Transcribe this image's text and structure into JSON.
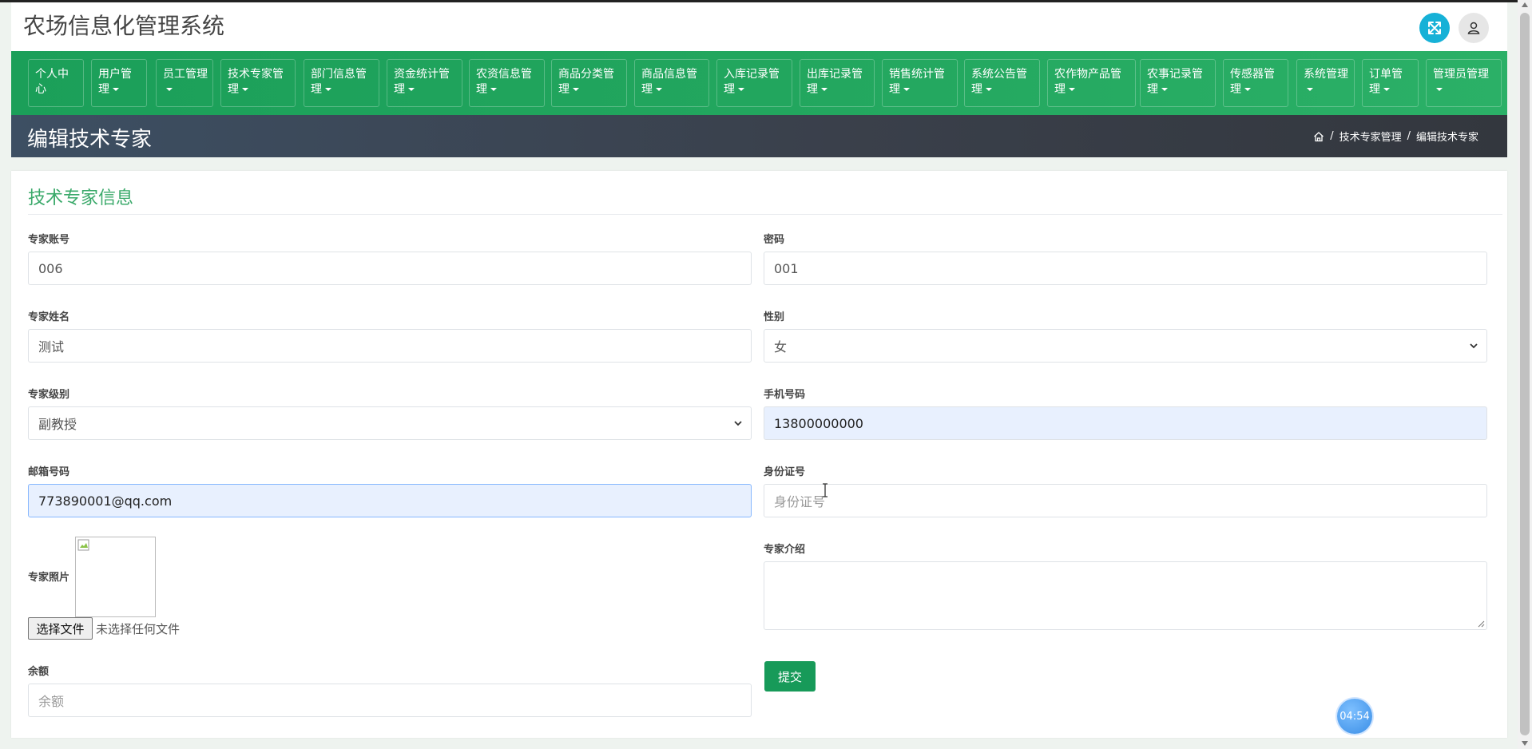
{
  "app": {
    "title": "农场信息化管理系统"
  },
  "header": {
    "expand_icon": "expand-arrows-icon",
    "user_icon": "user-icon"
  },
  "nav": {
    "items": [
      {
        "label": "个人中心",
        "has_caret": false
      },
      {
        "label": "用户管理",
        "has_caret": true
      },
      {
        "label": "员工管理",
        "has_caret": true
      },
      {
        "label": "技术专家管理",
        "has_caret": true
      },
      {
        "label": "部门信息管理",
        "has_caret": true
      },
      {
        "label": "资金统计管理",
        "has_caret": true
      },
      {
        "label": "农资信息管理",
        "has_caret": true
      },
      {
        "label": "商品分类管理",
        "has_caret": true
      },
      {
        "label": "商品信息管理",
        "has_caret": true
      },
      {
        "label": "入库记录管理",
        "has_caret": true
      },
      {
        "label": "出库记录管理",
        "has_caret": true
      },
      {
        "label": "销售统计管理",
        "has_caret": true
      },
      {
        "label": "系统公告管理",
        "has_caret": true
      },
      {
        "label": "农作物产品管理",
        "has_caret": true
      },
      {
        "label": "农事记录管理",
        "has_caret": true
      },
      {
        "label": "传感器管理",
        "has_caret": true
      },
      {
        "label": "系统管理",
        "has_caret": true
      },
      {
        "label": "订单管理",
        "has_caret": true
      },
      {
        "label": "管理员管理",
        "has_caret": true
      }
    ]
  },
  "page": {
    "title": "编辑技术专家",
    "breadcrumb": {
      "home_icon": "home-icon",
      "separator": "/",
      "level1": "技术专家管理",
      "level2": "编辑技术专家"
    }
  },
  "form": {
    "section_title": "技术专家信息",
    "account": {
      "label": "专家账号",
      "value": "006"
    },
    "password": {
      "label": "密码",
      "value": "001"
    },
    "name": {
      "label": "专家姓名",
      "value": "测试"
    },
    "gender": {
      "label": "性别",
      "selected": "女"
    },
    "level": {
      "label": "专家级别",
      "selected": "副教授"
    },
    "phone": {
      "label": "手机号码",
      "value": "13800000000"
    },
    "email": {
      "label": "邮箱号码",
      "value": "773890001@qq.com"
    },
    "id_card": {
      "label": "身份证号",
      "placeholder": "身份证号"
    },
    "photo": {
      "label": "专家照片",
      "file_button": "选择文件",
      "file_status": "未选择任何文件"
    },
    "intro": {
      "label": "专家介绍"
    },
    "balance": {
      "label": "余额",
      "placeholder": "余额"
    },
    "submit_label": "提交"
  },
  "overlay": {
    "timer": "04:54"
  },
  "colors": {
    "primary_green": "#1b9f59",
    "accent_cyan": "#16b1d7",
    "pagebar_dark": "#3a404b",
    "section_title_green": "#3aa96a"
  }
}
